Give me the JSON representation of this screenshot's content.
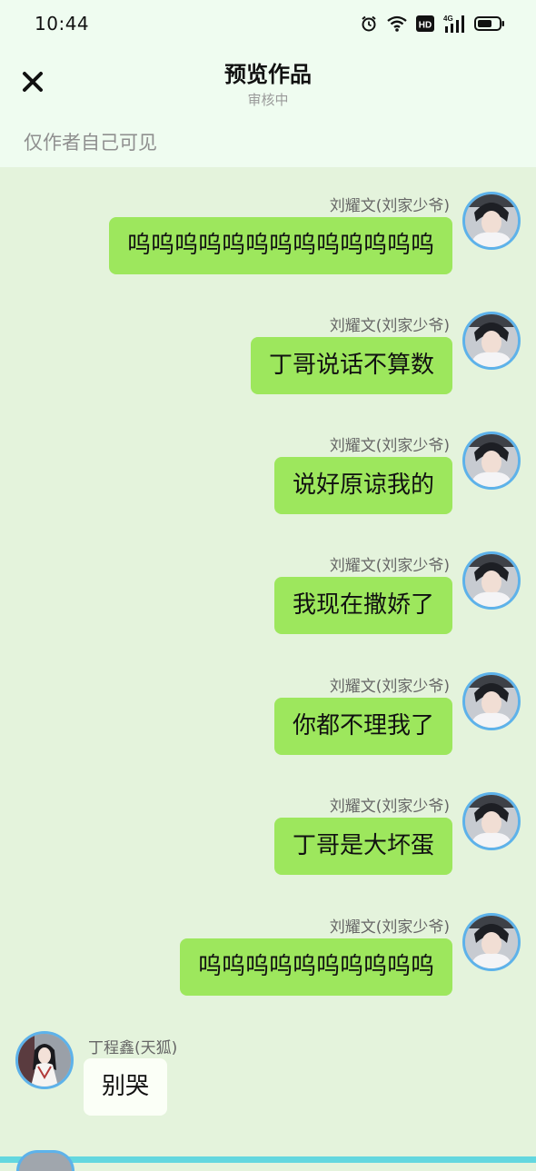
{
  "status_bar": {
    "time": "10:44",
    "icons": [
      "alarm-icon",
      "wifi-icon",
      "hd-icon",
      "4g-signal-icon",
      "battery-icon"
    ],
    "hd_label": "HD",
    "network_label": "4G"
  },
  "header": {
    "title": "预览作品",
    "subtitle": "审核中",
    "close_icon": "close-icon"
  },
  "visibility_note": "仅作者自己可见",
  "messages": [
    {
      "side": "right",
      "sender": "刘耀文(刘家少爷)",
      "text": "呜呜呜呜呜呜呜呜呜呜呜呜呜"
    },
    {
      "side": "right",
      "sender": "刘耀文(刘家少爷)",
      "text": "丁哥说话不算数"
    },
    {
      "side": "right",
      "sender": "刘耀文(刘家少爷)",
      "text": "说好原谅我的"
    },
    {
      "side": "right",
      "sender": "刘耀文(刘家少爷)",
      "text": "我现在撒娇了"
    },
    {
      "side": "right",
      "sender": "刘耀文(刘家少爷)",
      "text": "你都不理我了"
    },
    {
      "side": "right",
      "sender": "刘耀文(刘家少爷)",
      "text": "丁哥是大坏蛋"
    },
    {
      "side": "right",
      "sender": "刘耀文(刘家少爷)",
      "text": "呜呜呜呜呜呜呜呜呜呜"
    },
    {
      "side": "left",
      "sender": "丁程鑫(天狐)",
      "text": "别哭"
    }
  ],
  "colors": {
    "top_background": "#effcf0",
    "chat_background": "#e4f3dc",
    "right_bubble": "#9de75d",
    "left_bubble": "#fbfff7",
    "avatar_ring": "#5db2ea",
    "bottom_strip": "#63d7df"
  }
}
